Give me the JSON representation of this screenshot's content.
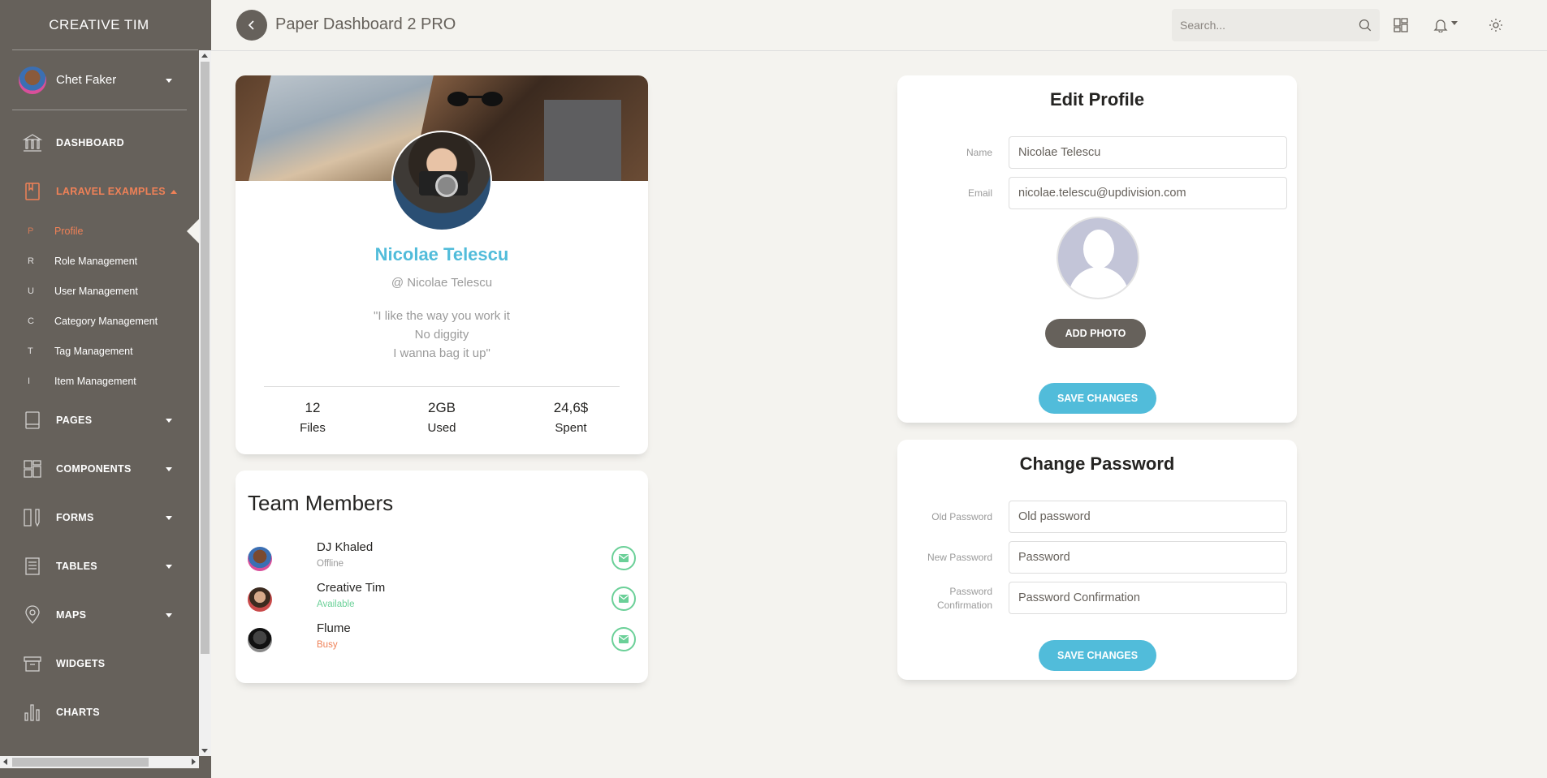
{
  "sidebar": {
    "logo": "CREATIVE TIM",
    "user": {
      "name": "Chet Faker"
    },
    "items": [
      {
        "label": "DASHBOARD",
        "icon": "bank-icon"
      },
      {
        "label": "LARAVEL EXAMPLES",
        "icon": "book-icon"
      },
      {
        "label": "PAGES",
        "icon": "book-bookmark-icon"
      },
      {
        "label": "COMPONENTS",
        "icon": "layout-icon"
      },
      {
        "label": "FORMS",
        "icon": "ruler-pencil-icon"
      },
      {
        "label": "TABLES",
        "icon": "paper-icon"
      },
      {
        "label": "MAPS",
        "icon": "pin-icon"
      },
      {
        "label": "WIDGETS",
        "icon": "box-icon"
      },
      {
        "label": "CHARTS",
        "icon": "chart-bar-icon"
      }
    ],
    "sub_items": [
      {
        "mini": "P",
        "label": "Profile"
      },
      {
        "mini": "R",
        "label": "Role Management"
      },
      {
        "mini": "U",
        "label": "User Management"
      },
      {
        "mini": "C",
        "label": "Category Management"
      },
      {
        "mini": "T",
        "label": "Tag Management"
      },
      {
        "mini": "I",
        "label": "Item Management"
      }
    ],
    "accent_color": "#ef8157"
  },
  "navbar": {
    "brand": "Paper Dashboard 2 PRO",
    "search_placeholder": "Search..."
  },
  "profile": {
    "name": "Nicolae Telescu",
    "handle": "@ Nicolae Telescu",
    "quote": [
      "\"I like the way you work it",
      "No diggity",
      "I wanna bag it up\""
    ],
    "stats": [
      {
        "value": "12",
        "label": "Files"
      },
      {
        "value": "2GB",
        "label": "Used"
      },
      {
        "value": "24,6$",
        "label": "Spent"
      }
    ]
  },
  "team": {
    "title": "Team Members",
    "members": [
      {
        "name": "DJ Khaled",
        "status": "Offline",
        "status_color": "#9a9a9a"
      },
      {
        "name": "Creative Tim",
        "status": "Available",
        "status_color": "#6bd098"
      },
      {
        "name": "Flume",
        "status": "Busy",
        "status_color": "#ef8157"
      }
    ]
  },
  "edit_profile": {
    "title": "Edit Profile",
    "name_label": "Name",
    "name_value": "Nicolae Telescu",
    "email_label": "Email",
    "email_value": "nicolae.telescu@updivision.com",
    "add_photo": "ADD PHOTO",
    "save": "SAVE CHANGES"
  },
  "change_password": {
    "title": "Change Password",
    "old_label": "Old Password",
    "old_placeholder": "Old password",
    "new_label": "New Password",
    "new_placeholder": "Password",
    "confirm_label": "Password Confirmation",
    "confirm_placeholder": "Password Confirmation",
    "save": "SAVE CHANGES"
  }
}
